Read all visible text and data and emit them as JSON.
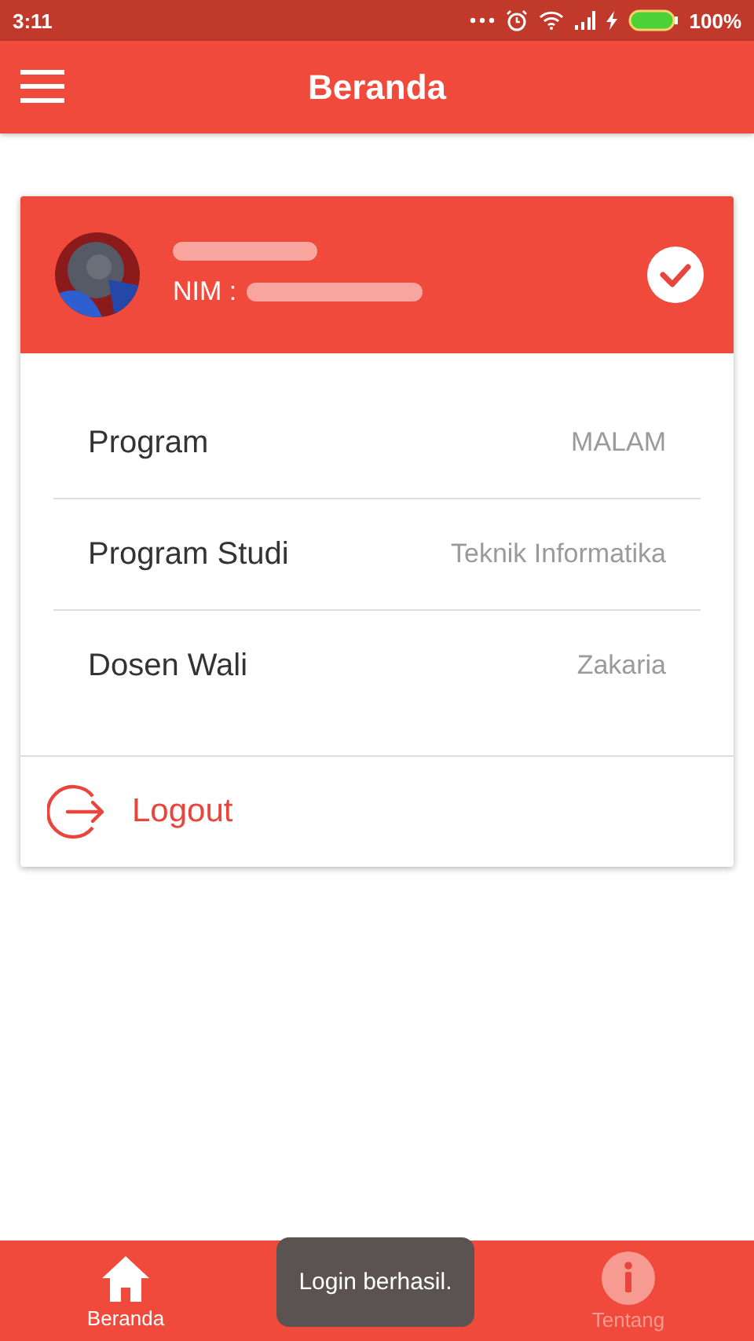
{
  "status_bar": {
    "time": "3:11",
    "battery": "100%"
  },
  "app_bar": {
    "title": "Beranda"
  },
  "profile": {
    "nim_label": "NIM :",
    "verified": true
  },
  "details": [
    {
      "label": "Program",
      "value": "MALAM"
    },
    {
      "label": "Program Studi",
      "value": "Teknik Informatika"
    },
    {
      "label": "Dosen Wali",
      "value": "Zakaria"
    }
  ],
  "logout": {
    "label": "Logout"
  },
  "bottom_nav": [
    {
      "kind": "home",
      "label": "Beranda",
      "selected": true
    },
    {
      "kind": "hidden"
    },
    {
      "kind": "info",
      "label": "Tentang",
      "selected": false
    }
  ],
  "toast": {
    "text": "Login berhasil."
  }
}
